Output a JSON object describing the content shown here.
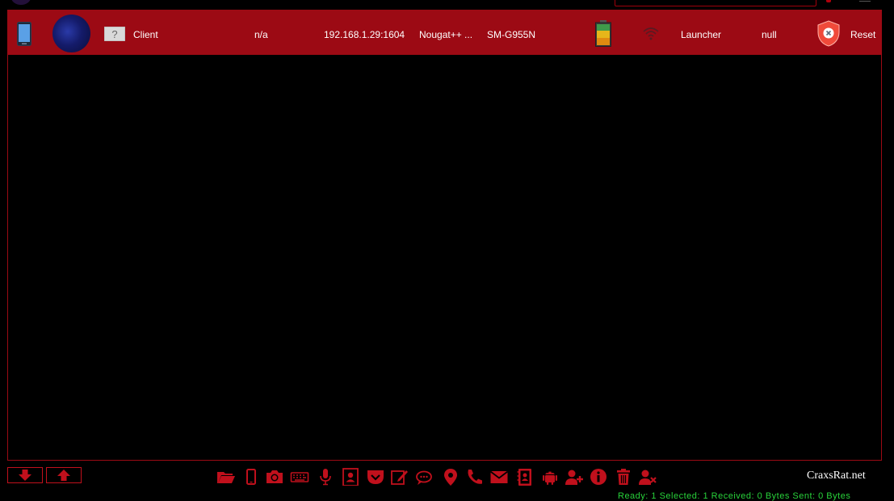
{
  "client_row": {
    "name": "Client",
    "country": "n/a",
    "ip_port": "192.168.1.29:1604",
    "android_version": "Nougat++ ...",
    "model": "SM-G955N",
    "current_app": "Launcher",
    "extra": "null",
    "action_label": "Reset",
    "icons": [
      "phone-icon",
      "wallpaper-thumbnail",
      "unknown-flag-icon",
      "battery-icon",
      "wifi-signal-icon",
      "shield-icon"
    ]
  },
  "toolbar": {
    "icons": [
      "folder-open-icon",
      "mobile-phone-icon",
      "camera-icon",
      "keyboard-icon",
      "microphone-icon",
      "contact-card-icon",
      "pocket-icon",
      "edit-note-icon",
      "chat-bubbles-icon",
      "location-pin-icon",
      "phone-call-icon",
      "envelope-icon",
      "address-book-icon",
      "android-icon",
      "add-user-icon",
      "info-icon",
      "trash-icon",
      "remove-user-icon"
    ],
    "scroll_down_icon": "arrow-down-icon",
    "scroll_up_icon": "arrow-up-icon"
  },
  "brand": "CraxsRat.net",
  "status": "Ready: 1    Selected: 1    Received: 0 Bytes    Sent: 0 Bytes",
  "colors": {
    "row_red": "#9c0a14",
    "icon_red": "#c0101c",
    "status_green": "#28d23a",
    "background": "#000000"
  }
}
